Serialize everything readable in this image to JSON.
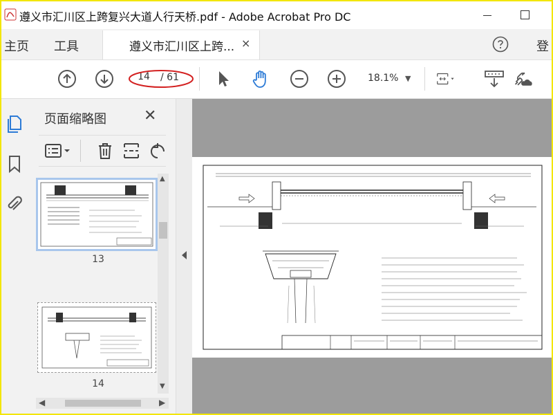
{
  "window": {
    "title": "遵义市汇川区上跨复兴大道人行天桥.pdf - Adobe Acrobat Pro DC"
  },
  "menu": {
    "home_label": "主页",
    "tools_label": "工具",
    "doc_tab_label": "遵义市汇川区上跨...",
    "doc_tab_close": "×",
    "signin_label": "登"
  },
  "toolbar": {
    "page_current": "14",
    "page_total": "/ 61",
    "zoom": "18.1%",
    "zoom_dropdown": "▼"
  },
  "thumbnails": {
    "title": "页面缩略图",
    "close": "✕",
    "pages": [
      {
        "number": "13",
        "selected": true
      },
      {
        "number": "14",
        "selected": false
      }
    ]
  },
  "colors": {
    "accent_blue": "#2d7bd6",
    "ellipse_red": "#d32020",
    "frame_yellow": "#f3e600"
  },
  "icons": {
    "prev_page": "arrow-up-circle-icon",
    "next_page": "arrow-down-circle-icon",
    "select": "cursor-arrow-icon",
    "hand": "hand-icon",
    "zoom_out": "minus-circle-icon",
    "zoom_in": "plus-circle-icon"
  }
}
